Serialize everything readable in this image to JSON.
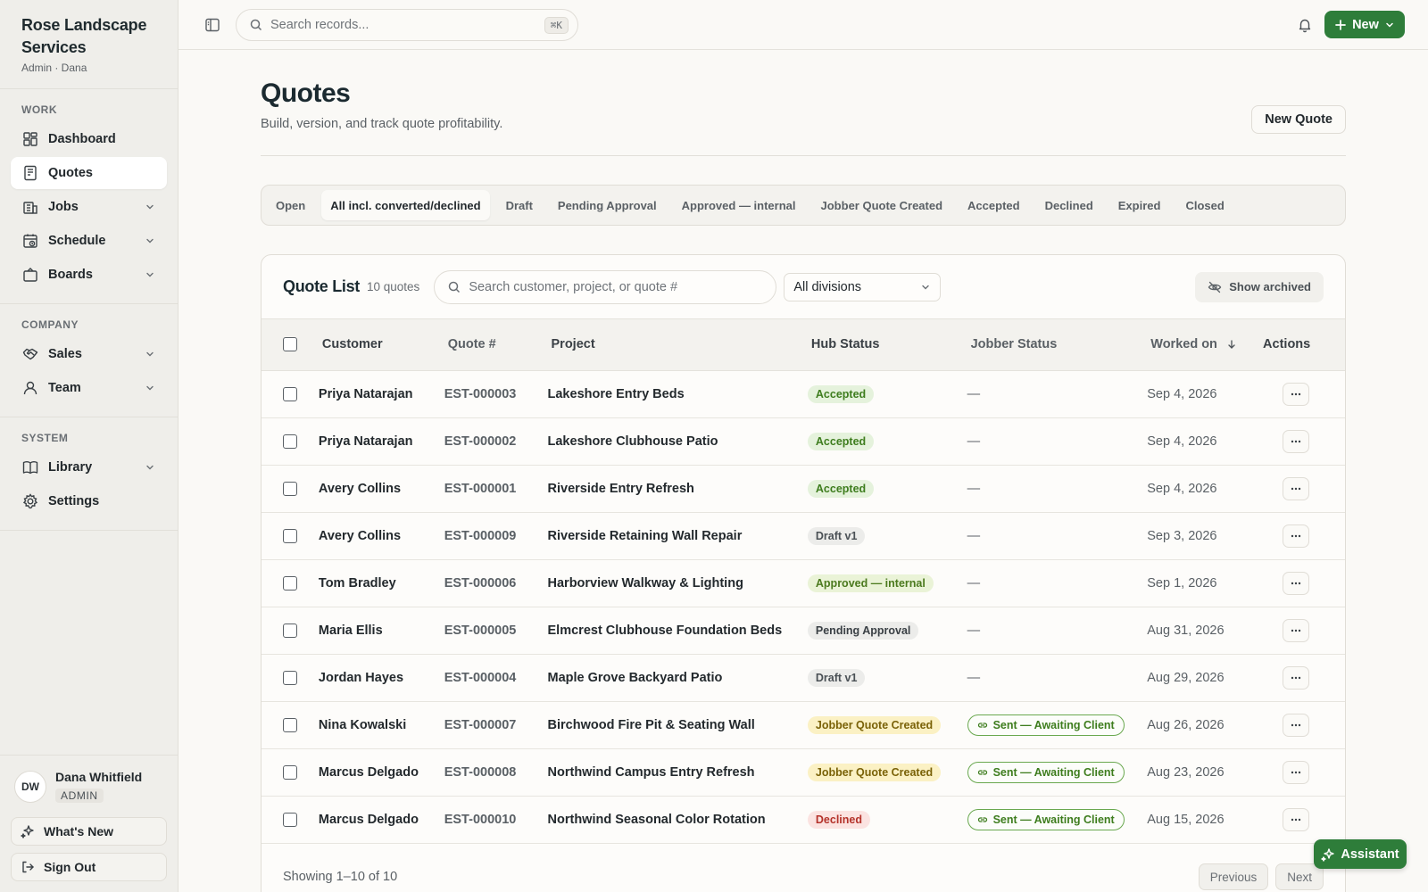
{
  "brand": {
    "name": "Rose Landscape Services",
    "sub": "Admin · Dana"
  },
  "sidebar": {
    "sections": [
      {
        "title": "WORK",
        "items": [
          {
            "label": "Dashboard",
            "icon": "dashboard-icon"
          },
          {
            "label": "Quotes",
            "icon": "quotes-icon",
            "active": true
          },
          {
            "label": "Jobs",
            "icon": "jobs-icon",
            "expandable": true
          },
          {
            "label": "Schedule",
            "icon": "schedule-icon",
            "expandable": true
          },
          {
            "label": "Boards",
            "icon": "boards-icon",
            "expandable": true
          }
        ]
      },
      {
        "title": "COMPANY",
        "items": [
          {
            "label": "Sales",
            "icon": "sales-icon",
            "expandable": true
          },
          {
            "label": "Team",
            "icon": "team-icon",
            "expandable": true
          }
        ]
      },
      {
        "title": "SYSTEM",
        "items": [
          {
            "label": "Library",
            "icon": "library-icon",
            "expandable": true
          },
          {
            "label": "Settings",
            "icon": "settings-icon"
          }
        ]
      }
    ],
    "user": {
      "initials": "DW",
      "name": "Dana Whitfield",
      "role": "ADMIN"
    },
    "whats_new": "What's New",
    "sign_out": "Sign Out"
  },
  "topbar": {
    "search_placeholder": "Search records...",
    "shortcut": "⌘K",
    "new_label": "New"
  },
  "page": {
    "title": "Quotes",
    "subtitle": "Build, version, and track quote profitability.",
    "new_quote": "New Quote"
  },
  "tabs": [
    {
      "label": "Open"
    },
    {
      "label": "All incl. converted/declined",
      "active": true
    },
    {
      "label": "Draft"
    },
    {
      "label": "Pending Approval"
    },
    {
      "label": "Approved — internal"
    },
    {
      "label": "Jobber Quote Created"
    },
    {
      "label": "Accepted"
    },
    {
      "label": "Declined"
    },
    {
      "label": "Expired"
    },
    {
      "label": "Closed"
    }
  ],
  "list": {
    "title": "Quote List",
    "count": "10 quotes",
    "search_placeholder": "Search customer, project, or quote #",
    "division": "All divisions",
    "show_archived": "Show archived",
    "columns": {
      "customer": "Customer",
      "quote": "Quote #",
      "project": "Project",
      "hub": "Hub Status",
      "jobber": "Jobber Status",
      "worked": "Worked on",
      "actions": "Actions"
    },
    "rows": [
      {
        "customer": "Priya Natarajan",
        "quote": "EST-000003",
        "project": "Lakeshore Entry Beds",
        "hub": "Accepted",
        "hub_kind": "accepted",
        "jobber": "—",
        "date": "Sep 4, 2026"
      },
      {
        "customer": "Priya Natarajan",
        "quote": "EST-000002",
        "project": "Lakeshore Clubhouse Patio",
        "hub": "Accepted",
        "hub_kind": "accepted",
        "jobber": "—",
        "date": "Sep 4, 2026"
      },
      {
        "customer": "Avery Collins",
        "quote": "EST-000001",
        "project": "Riverside Entry Refresh",
        "hub": "Accepted",
        "hub_kind": "accepted",
        "jobber": "—",
        "date": "Sep 4, 2026"
      },
      {
        "customer": "Avery Collins",
        "quote": "EST-000009",
        "project": "Riverside Retaining Wall Repair",
        "hub": "Draft v1",
        "hub_kind": "draft",
        "jobber": "—",
        "date": "Sep 3, 2026"
      },
      {
        "customer": "Tom Bradley",
        "quote": "EST-000006",
        "project": "Harborview Walkway & Lighting",
        "hub": "Approved — internal",
        "hub_kind": "approved",
        "jobber": "—",
        "date": "Sep 1, 2026"
      },
      {
        "customer": "Maria Ellis",
        "quote": "EST-000005",
        "project": "Elmcrest Clubhouse Foundation Beds",
        "hub": "Pending Approval",
        "hub_kind": "pending",
        "jobber": "—",
        "date": "Aug 31, 2026"
      },
      {
        "customer": "Jordan Hayes",
        "quote": "EST-000004",
        "project": "Maple Grove Backyard Patio",
        "hub": "Draft v1",
        "hub_kind": "draft",
        "jobber": "—",
        "date": "Aug 29, 2026"
      },
      {
        "customer": "Nina Kowalski",
        "quote": "EST-000007",
        "project": "Birchwood Fire Pit & Seating Wall",
        "hub": "Jobber Quote Created",
        "hub_kind": "jobber",
        "jobber": "Sent — Awaiting Client",
        "jobber_pill": true,
        "date": "Aug 26, 2026"
      },
      {
        "customer": "Marcus Delgado",
        "quote": "EST-000008",
        "project": "Northwind Campus Entry Refresh",
        "hub": "Jobber Quote Created",
        "hub_kind": "jobber",
        "jobber": "Sent — Awaiting Client",
        "jobber_pill": true,
        "date": "Aug 23, 2026"
      },
      {
        "customer": "Marcus Delgado",
        "quote": "EST-000010",
        "project": "Northwind Seasonal Color Rotation",
        "hub": "Declined",
        "hub_kind": "declined",
        "jobber": "Sent — Awaiting Client",
        "jobber_pill": true,
        "date": "Aug 15, 2026"
      }
    ],
    "footer": "Showing 1–10 of 10",
    "prev": "Previous",
    "next": "Next"
  },
  "assistant": "Assistant",
  "colors": {
    "accent": "#2e7d3a",
    "sidebar_bg": "#efeeea",
    "page_bg": "#faf9f6"
  }
}
